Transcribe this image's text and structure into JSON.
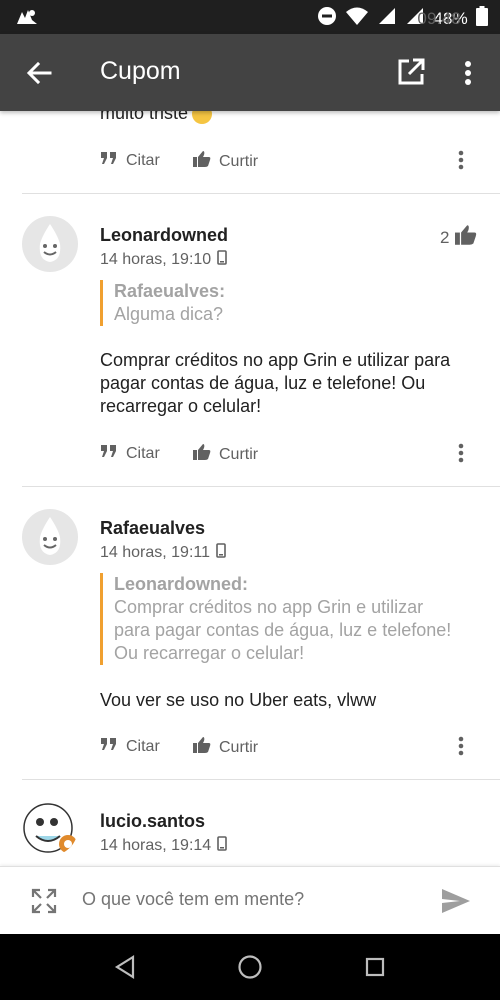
{
  "status_bar": {
    "battery_percent": "48%",
    "time": "09:48"
  },
  "toolbar": {
    "title": "Cupom"
  },
  "previous_post": {
    "tail_text": "muito triste",
    "actions": {
      "quote": "Citar",
      "like": "Curtir"
    }
  },
  "posts": [
    {
      "author": "Leonardowned",
      "time": "14 horas, 19:10",
      "likes": "2",
      "quote_author": "Rafaeualves:",
      "quote_lines": [
        "Alguma dica?"
      ],
      "body_lines": [
        "Comprar créditos no app Grin e utilizar para",
        "pagar contas de água, luz e telefone! Ou",
        "recarregar o celular!"
      ],
      "actions": {
        "quote": "Citar",
        "like": "Curtir"
      }
    },
    {
      "author": "Rafaeualves",
      "time": "14 horas, 19:11",
      "quote_author": "Leonardowned:",
      "quote_lines": [
        "Comprar créditos no app Grin e utilizar",
        "para pagar contas de água, luz e telefone!",
        "Ou recarregar o celular!"
      ],
      "body_lines": [
        "Vou ver se uso no Uber eats, vlww"
      ],
      "actions": {
        "quote": "Citar",
        "like": "Curtir"
      }
    },
    {
      "author": "lucio.santos",
      "time": "14 horas, 19:14"
    }
  ],
  "composer": {
    "placeholder": "O que você tem em mente?"
  },
  "colors": {
    "toolbar": "#434343",
    "quote_bar": "#f0a030",
    "status_bar": "#1f1f1f"
  }
}
